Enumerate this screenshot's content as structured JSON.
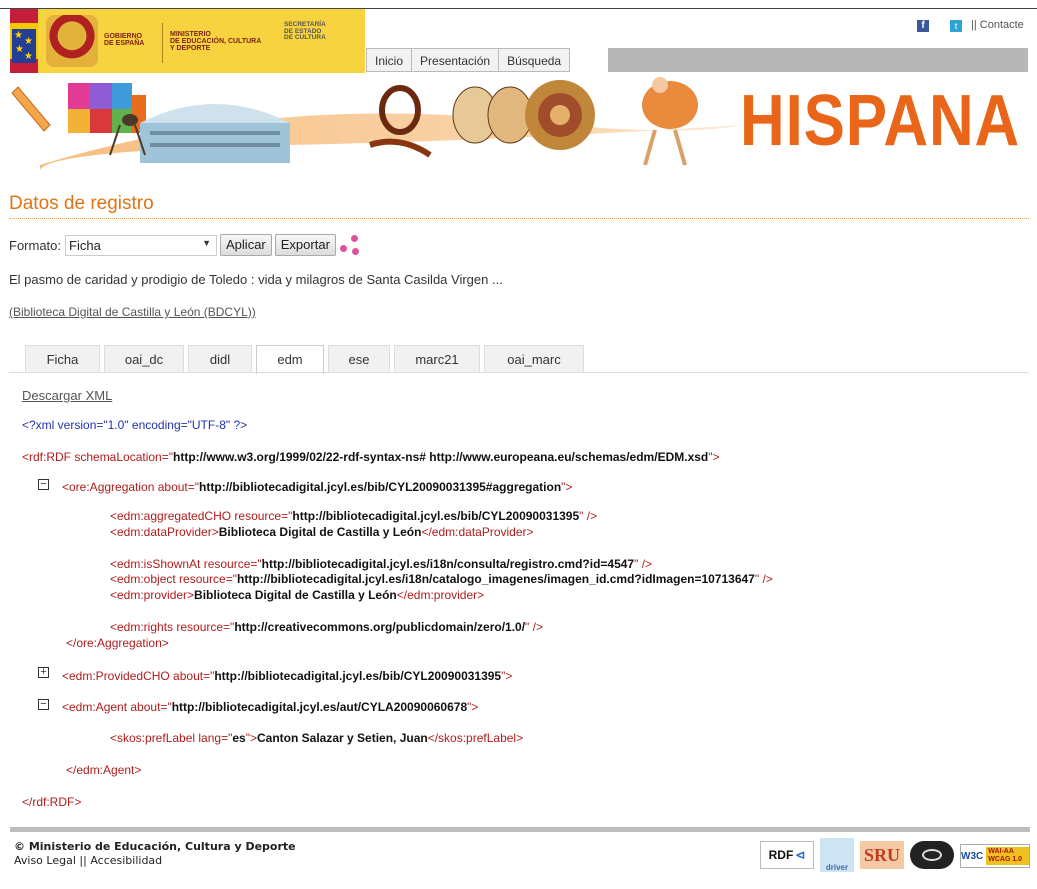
{
  "header": {
    "gov_line1": "GOBIERNO",
    "gov_line2": "DE ESPAÑA",
    "ministry_line1": "MINISTERIO",
    "ministry_line2": "DE EDUCACIÓN, CULTURA",
    "ministry_line3": "Y DEPORTE",
    "secretaria_line1": "SECRETARÍA",
    "secretaria_line2": "DE ESTADO",
    "secretaria_line3": "DE CULTURA",
    "nav": [
      "Inicio",
      "Presentación",
      "Búsqueda"
    ],
    "contact": "|| Contacte",
    "facebook_icon": "facebook-icon",
    "twitter_icon": "twitter-icon",
    "banner_text": "HISPANA",
    "brand_color": "#e8651a"
  },
  "main": {
    "page_title": "Datos de registro",
    "format_label": "Formato:",
    "format_value": "Ficha",
    "apply_label": "Aplicar",
    "export_label": "Exportar",
    "share_icon": "share-icon",
    "record_title": "El pasmo de caridad y prodigio de Toledo : vida y milagros de Santa Casilda Virgen ...",
    "source_link": "(Biblioteca Digital de Castilla y León (BDCYL))",
    "tabs": [
      "Ficha",
      "oai_dc",
      "didl",
      "edm",
      "ese",
      "marc21",
      "oai_marc"
    ],
    "active_tab": "edm",
    "download_xml": "Descargar XML"
  },
  "xml": {
    "declaration": "<?xml version=\"1.0\" encoding=\"UTF-8\" ?>",
    "rdf_open_tag": "<rdf:RDF schemaLocation=\"",
    "rdf_open_val": "http://www.w3.org/1999/02/22-rdf-syntax-ns# http://www.europeana.eu/schemas/edm/EDM.xsd",
    "rdf_open_end": "\">",
    "agg_open_tag": "<ore:Aggregation about=\"",
    "agg_open_val": "http://bibliotecadigital.jcyl.es/bib/CYL20090031395#aggregation",
    "agg_open_end": "\">",
    "cho_tag": "<edm:aggregatedCHO resource=\"",
    "cho_val": "http://bibliotecadigital.jcyl.es/bib/CYL20090031395",
    "cho_end": "\" />",
    "dp_tag": "<edm:dataProvider>",
    "dp_val": "Biblioteca Digital de Castilla y León",
    "dp_end": "</edm:dataProvider>",
    "isa_tag": "<edm:isShownAt resource=\"",
    "isa_val": "http://bibliotecadigital.jcyl.es/i18n/consulta/registro.cmd?id=4547",
    "isa_end": "\" />",
    "obj_tag": "<edm:object resource=\"",
    "obj_val": "http://bibliotecadigital.jcyl.es/i18n/catalogo_imagenes/imagen_id.cmd?idImagen=10713647",
    "obj_end": "\" />",
    "prov_tag": "<edm:provider>",
    "prov_val": "Biblioteca Digital de Castilla y León",
    "prov_end": "</edm:provider>",
    "rights_tag": "<edm:rights resource=\"",
    "rights_val": "http://creativecommons.org/publicdomain/zero/1.0/",
    "rights_end": "\" />",
    "agg_close": "</ore:Aggregation>",
    "pcho_tag": "<edm:ProvidedCHO about=\"",
    "pcho_val": "http://bibliotecadigital.jcyl.es/bib/CYL20090031395",
    "pcho_end": "\">",
    "agent_tag": "<edm:Agent about=\"",
    "agent_val": "http://bibliotecadigital.jcyl.es/aut/CYLA20090060678",
    "agent_end": "\">",
    "pref_tag": "<skos:prefLabel lang=\"",
    "pref_lang": "es",
    "pref_mid": "\">",
    "pref_val": "Canton Salazar y Setien, Juan",
    "pref_end": "</skos:prefLabel>",
    "agent_close": "</edm:Agent>",
    "rdf_close": "</rdf:RDF>",
    "minus": "−",
    "plus": "+"
  },
  "footer": {
    "copyright": "© Ministerio de Educación, Cultura y Deporte",
    "legal": "Aviso Legal",
    "separator": "||",
    "accessibility": "Accesibilidad",
    "badges": [
      "RDF",
      "driver",
      "SRU",
      "W3C",
      "WAI-AA WCAG 1.0"
    ]
  }
}
